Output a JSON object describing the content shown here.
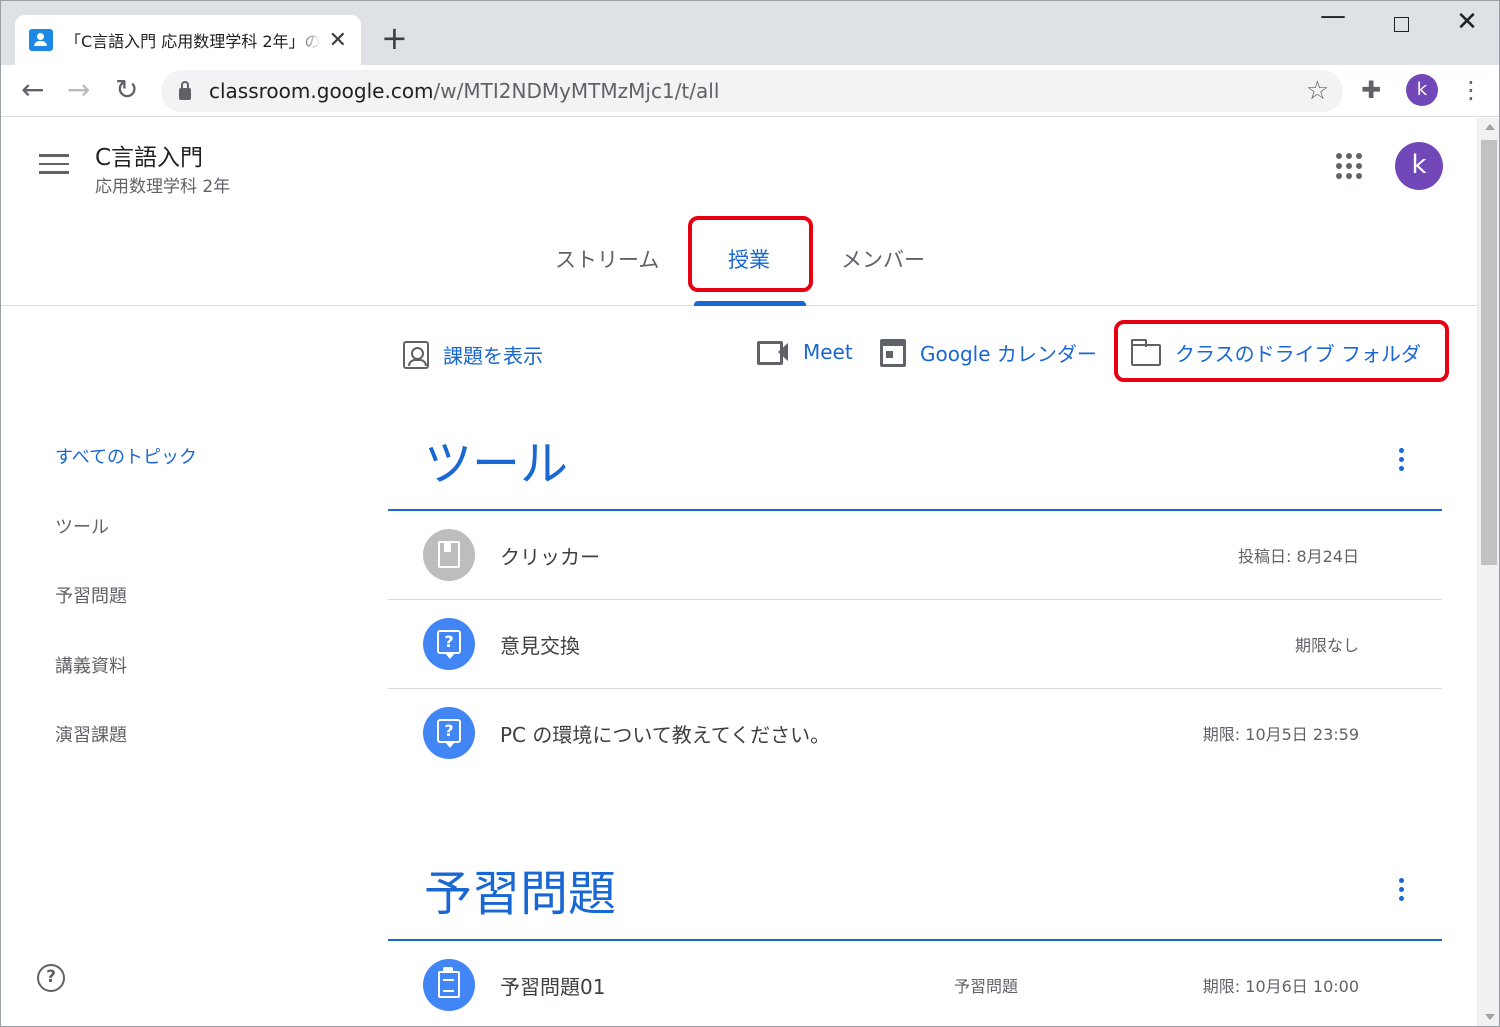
{
  "browser": {
    "tab_title": "「C言語入門 応用数理学科 2年」の",
    "tab_close": "✕",
    "new_tab": "+",
    "url_host": "classroom.google.com",
    "url_path": "/w/MTI2NDMyMTMzMjc1/t/all",
    "profile_initial": "k"
  },
  "header": {
    "class_name": "C言語入門",
    "class_section": "応用数理学科 2年",
    "avatar_initial": "k"
  },
  "tabs": [
    {
      "label": "ストリーム",
      "active": false
    },
    {
      "label": "授業",
      "active": true
    },
    {
      "label": "メンバー",
      "active": false
    }
  ],
  "actions": {
    "view_assignments": "課題を表示",
    "meet": "Meet",
    "calendar": "Google カレンダー",
    "drive_folder": "クラスのドライブ フォルダ"
  },
  "sidebar": {
    "items": [
      {
        "label": "すべてのトピック",
        "active": true
      },
      {
        "label": "ツール",
        "active": false
      },
      {
        "label": "予習問題",
        "active": false
      },
      {
        "label": "講義資料",
        "active": false
      },
      {
        "label": "演習課題",
        "active": false
      }
    ]
  },
  "topics": [
    {
      "title": "ツール",
      "items": [
        {
          "icon": "material-icon",
          "title": "クリッカー",
          "meta": "投稿日: 8月24日"
        },
        {
          "icon": "question-icon",
          "title": "意見交換",
          "meta": "期限なし"
        },
        {
          "icon": "question-icon",
          "title": "PC の環境について教えてください。",
          "meta": "期限: 10月5日 23:59"
        }
      ]
    },
    {
      "title": "予習問題",
      "items": [
        {
          "icon": "assignment-icon",
          "title": "予習問題01",
          "tag": "予習問題",
          "meta": "期限: 10月6日 10:00"
        }
      ]
    }
  ],
  "colors": {
    "accent": "#1967d2",
    "highlight_box": "#e60012",
    "avatar": "#7248b9"
  }
}
